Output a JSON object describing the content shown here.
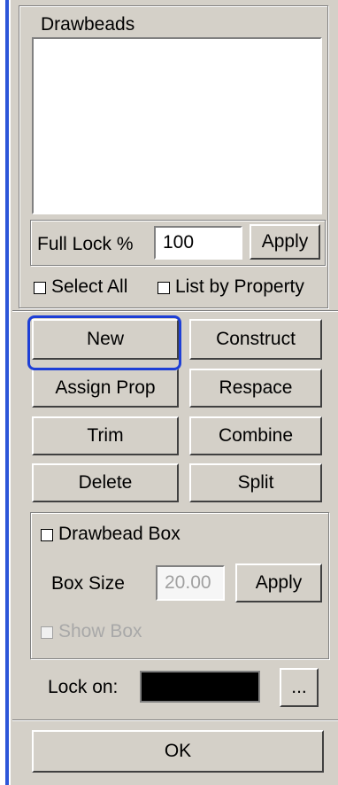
{
  "drawbeads": {
    "title": "Drawbeads",
    "full_lock_label": "Full Lock %",
    "full_lock_value": "100",
    "apply_label": "Apply",
    "select_all_label": "Select All",
    "list_by_property_label": "List by Property"
  },
  "actions": {
    "new": "New",
    "construct": "Construct",
    "assign_prop": "Assign Prop",
    "respace": "Respace",
    "trim": "Trim",
    "combine": "Combine",
    "delete": "Delete",
    "split": "Split"
  },
  "box": {
    "drawbead_box_label": "Drawbead Box",
    "box_size_label": "Box Size",
    "box_size_value": "20.00",
    "apply_label": "Apply",
    "show_box_label": "Show Box"
  },
  "lock_on": {
    "label": "Lock on:",
    "color": "#000000",
    "more_label": "..."
  },
  "ok_label": "OK",
  "colors": {
    "panel_bg": "#d4d0c8",
    "highlight": "#1e3fd6",
    "left_bar": "#2d56d9"
  }
}
